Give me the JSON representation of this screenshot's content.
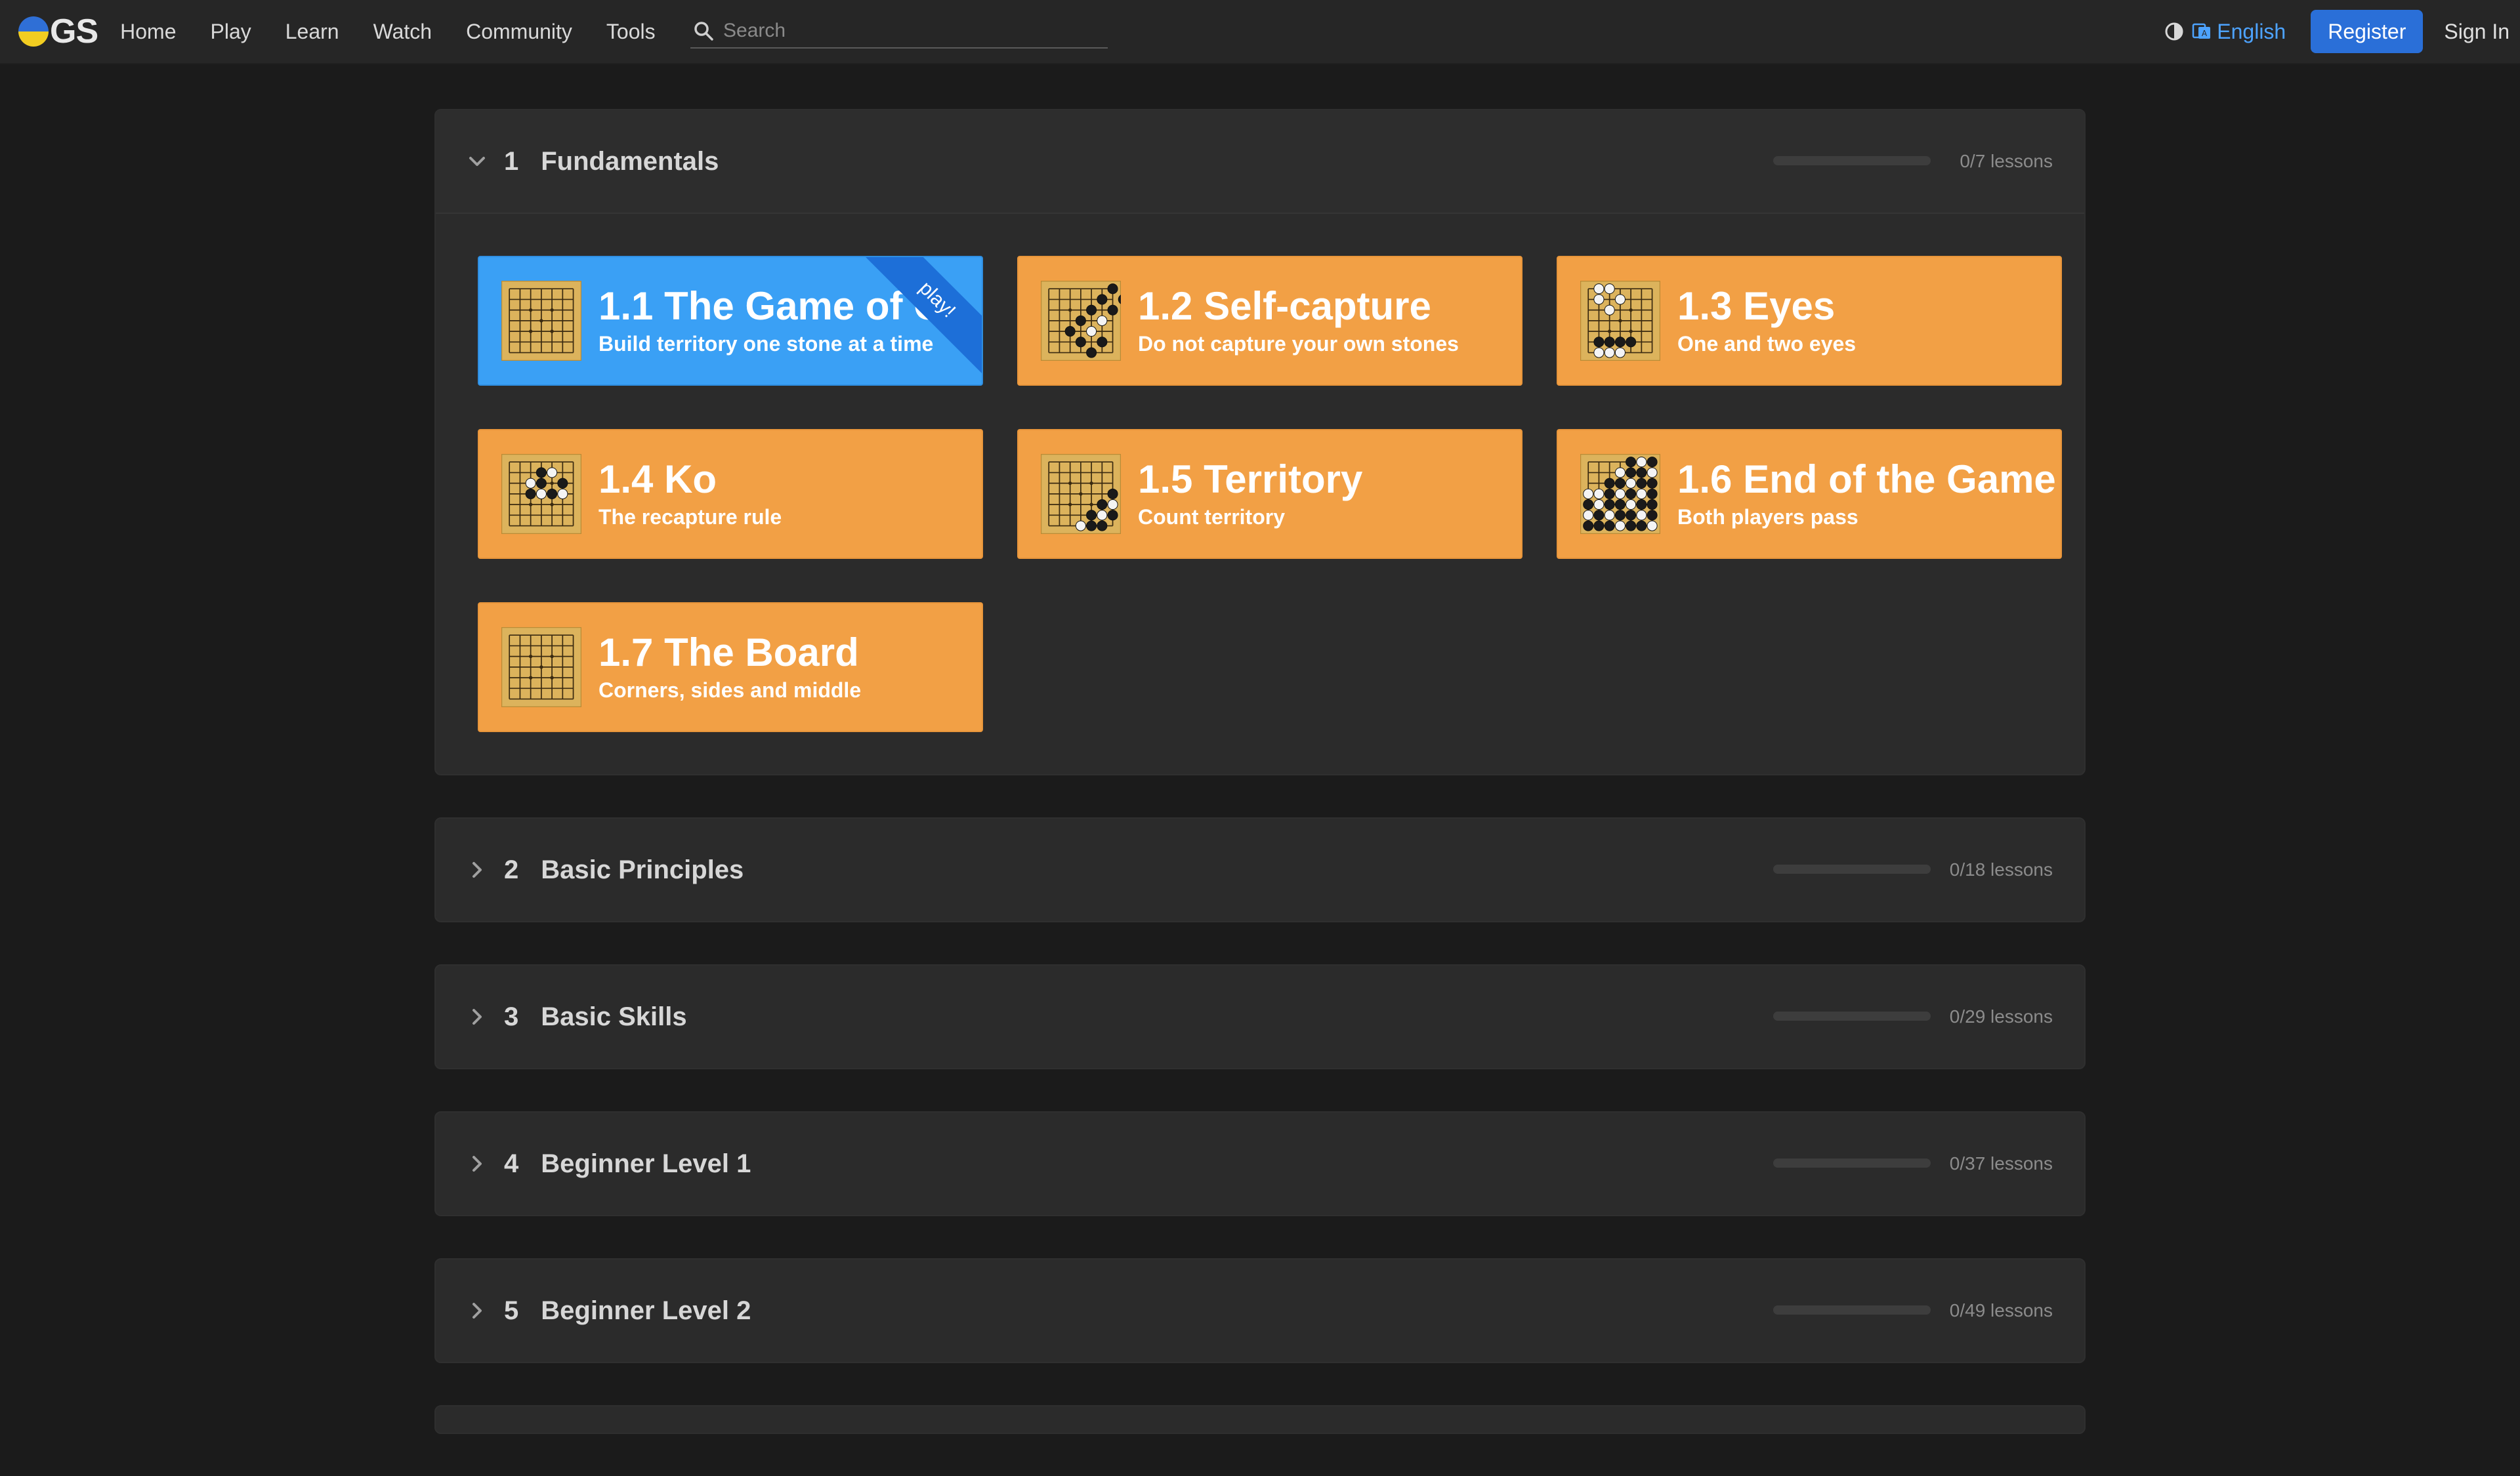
{
  "brand": {
    "logo_text": "GS"
  },
  "nav": {
    "links": [
      "Home",
      "Play",
      "Learn",
      "Watch",
      "Community",
      "Tools"
    ]
  },
  "search": {
    "placeholder": "Search"
  },
  "header_right": {
    "language": "English",
    "register": "Register",
    "sign_in": "Sign In"
  },
  "colors": {
    "lesson_bg": "#f2a045",
    "active_lesson_bg": "#3aa0f5",
    "register_bg": "#2a6fd8",
    "link": "#4da3ff"
  },
  "sections": [
    {
      "num": "1",
      "title": "Fundamentals",
      "count": "0/7 lessons",
      "progress": 0,
      "expanded": true,
      "lessons": [
        {
          "title": "1.1 The Game of Go",
          "subtitle": "Build territory one stone at a time",
          "active": true,
          "ribbon": "play!"
        },
        {
          "title": "1.2 Self-capture",
          "subtitle": "Do not capture your own stones"
        },
        {
          "title": "1.3 Eyes",
          "subtitle": "One and two eyes"
        },
        {
          "title": "1.4 Ko",
          "subtitle": "The recapture rule"
        },
        {
          "title": "1.5 Territory",
          "subtitle": "Count territory"
        },
        {
          "title": "1.6 End of the Game",
          "subtitle": "Both players pass"
        },
        {
          "title": "1.7 The Board",
          "subtitle": "Corners, sides and middle"
        }
      ]
    },
    {
      "num": "2",
      "title": "Basic Principles",
      "count": "0/18 lessons",
      "progress": 0
    },
    {
      "num": "3",
      "title": "Basic Skills",
      "count": "0/29 lessons",
      "progress": 0
    },
    {
      "num": "4",
      "title": "Beginner Level 1",
      "count": "0/37 lessons",
      "progress": 0
    },
    {
      "num": "5",
      "title": "Beginner Level 2",
      "count": "0/49 lessons",
      "progress": 0
    }
  ]
}
